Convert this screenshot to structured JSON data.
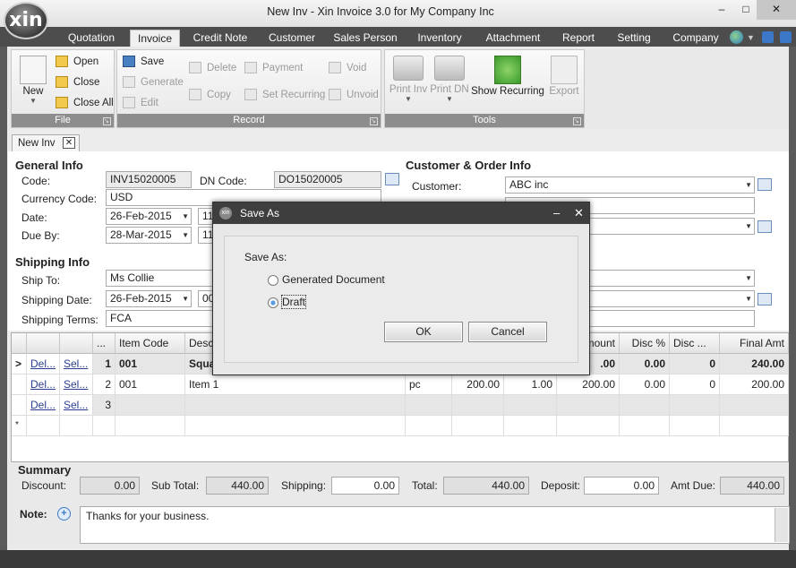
{
  "window": {
    "title": "New Inv - Xin Invoice 3.0 for My Company Inc",
    "logo": "xin",
    "minimize": "–",
    "maximize": "□",
    "close": "✕"
  },
  "tabs": [
    "Quotation",
    "Invoice",
    "Credit Note",
    "Customer",
    "Sales Person",
    "Inventory",
    "Attachment",
    "Report",
    "Setting",
    "Company"
  ],
  "active_tab": "Invoice",
  "ribbon": {
    "file": {
      "label": "File",
      "new": "New",
      "open": "Open",
      "close": "Close",
      "close_all": "Close All"
    },
    "record": {
      "label": "Record",
      "save": "Save",
      "generate": "Generate",
      "edit": "Edit",
      "delete": "Delete",
      "copy": "Copy",
      "payment": "Payment",
      "set_recurring": "Set Recurring",
      "void": "Void",
      "unvoid": "Unvoid"
    },
    "tools": {
      "label": "Tools",
      "print_inv": "Print Inv",
      "print_dn": "Print DN",
      "show_recurring": "Show Recurring",
      "export": "Export"
    }
  },
  "doc_tab": {
    "label": "New Inv",
    "close": "✕"
  },
  "general_info": {
    "title": "General Info",
    "code_label": "Code:",
    "code": "INV15020005",
    "dn_label": "DN Code:",
    "dn": "DO15020005",
    "currency_label": "Currency Code:",
    "currency": "USD",
    "date_label": "Date:",
    "date": "26-Feb-2015",
    "date_time": "11",
    "due_label": "Due By:",
    "due": "28-Mar-2015",
    "due_time": "11"
  },
  "shipping_info": {
    "title": "Shipping Info",
    "ship_to_label": "Ship To:",
    "ship_to": "Ms Collie",
    "ship_date_label": "Shipping Date:",
    "ship_date": "26-Feb-2015",
    "ship_time": "00",
    "terms_label": "Shipping Terms:",
    "terms": "FCA"
  },
  "customer_info": {
    "title": "Customer & Order Info",
    "customer_label": "Customer:",
    "customer": "ABC inc"
  },
  "grid": {
    "headers": [
      "...",
      "Item Code",
      "Desc",
      "mount",
      "Disc %",
      "Disc ...",
      "Final Amt"
    ],
    "rows": [
      {
        "marker": ">",
        "del": "Del...",
        "sel": "Sel...",
        "no": "1",
        "code": "001",
        "desc": "Squa",
        "unit": "",
        "qty": "",
        "price": "",
        "amount": ".00",
        "disc_pct": "0.00",
        "disc": "0",
        "final": "240.00"
      },
      {
        "marker": "",
        "del": "Del...",
        "sel": "Sel...",
        "no": "2",
        "code": "001",
        "desc": "Item 1",
        "unit": "pc",
        "qty": "200.00",
        "price": "1.00",
        "amount": "200.00",
        "disc_pct": "0.00",
        "disc": "0",
        "final": "200.00"
      },
      {
        "marker": "",
        "del": "Del...",
        "sel": "Sel...",
        "no": "3",
        "code": "",
        "desc": "",
        "unit": "",
        "qty": "",
        "price": "",
        "amount": "",
        "disc_pct": "",
        "disc": "",
        "final": ""
      }
    ],
    "new_row_marker": "*"
  },
  "summary": {
    "title": "Summary",
    "discount_label": "Discount:",
    "discount": "0.00",
    "subtotal_label": "Sub Total:",
    "subtotal": "440.00",
    "shipping_label": "Shipping:",
    "shipping": "0.00",
    "total_label": "Total:",
    "total": "440.00",
    "deposit_label": "Deposit:",
    "deposit": "0.00",
    "amt_due_label": "Amt Due:",
    "amt_due": "440.00",
    "note_label": "Note:",
    "note": "Thanks for your business."
  },
  "dialog": {
    "title": "Save As",
    "minimize": "–",
    "close": "✕",
    "prompt": "Save As:",
    "option_generated": "Generated Document",
    "option_draft": "Draft",
    "selected": "Draft",
    "ok": "OK",
    "cancel": "Cancel"
  }
}
